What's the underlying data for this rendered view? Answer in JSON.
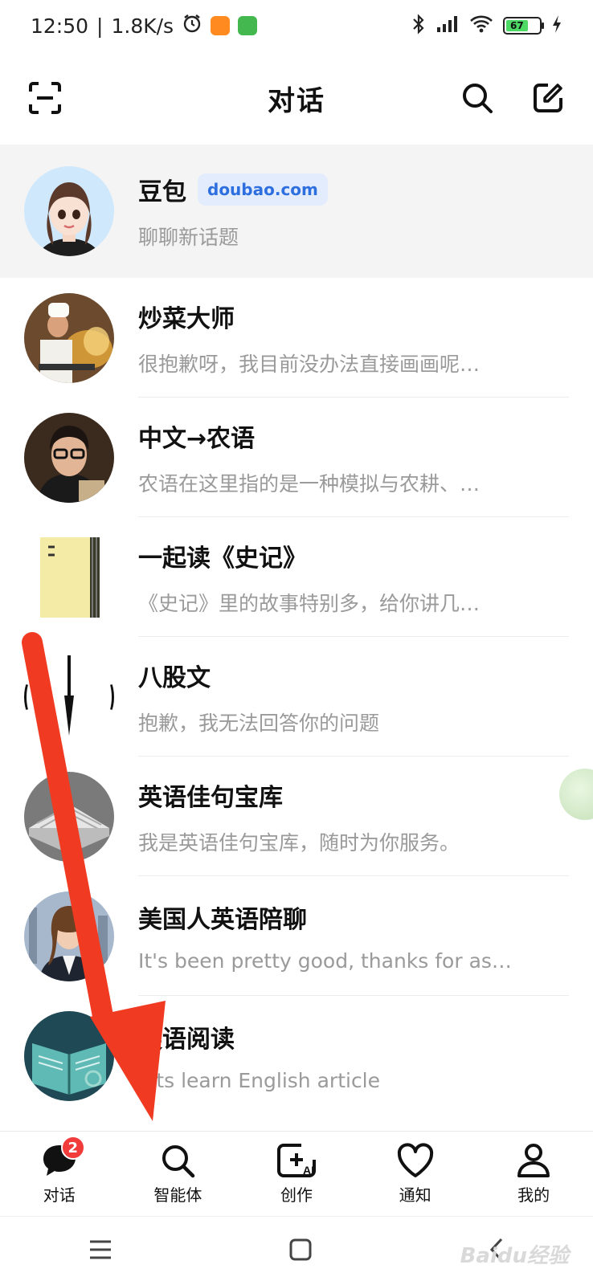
{
  "status_bar": {
    "time": "12:50",
    "speed": "1.8K/s",
    "battery": "67"
  },
  "header": {
    "title": "对话"
  },
  "chats": [
    {
      "name": "豆包",
      "badge": "doubao.com",
      "preview": "聊聊新话题"
    },
    {
      "name": "炒菜大师",
      "preview": "很抱歉呀，我目前没办法直接画画呢…"
    },
    {
      "name": "中文→农语",
      "preview": "农语在这里指的是一种模拟与农耕、…"
    },
    {
      "name": "一起读《史记》",
      "preview": "《史记》里的故事特别多，给你讲几…"
    },
    {
      "name": "八股文",
      "preview": "抱歉，我无法回答你的问题"
    },
    {
      "name": "英语佳句宝库",
      "preview": "我是英语佳句宝库，随时为你服务。"
    },
    {
      "name": "美国人英语陪聊",
      "preview": "It's been pretty good, thanks for ask…"
    },
    {
      "name": "英语阅读",
      "preview": "lets learn English article"
    }
  ],
  "tabs": [
    {
      "label": "对话",
      "badge": "2"
    },
    {
      "label": "智能体"
    },
    {
      "label": "创作"
    },
    {
      "label": "通知"
    },
    {
      "label": "我的"
    }
  ],
  "watermark": "Baidu经验",
  "colors": {
    "accent_blue": "#2e6fe0",
    "badge_red": "#f23b3b",
    "arrow_red": "#f03a22"
  }
}
